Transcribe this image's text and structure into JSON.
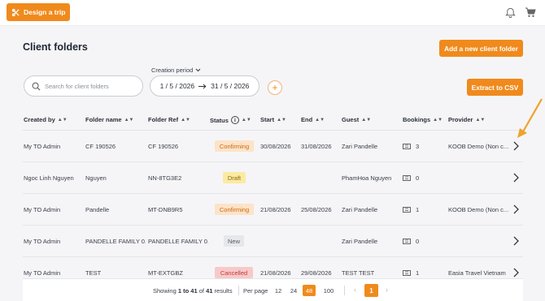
{
  "topbar": {
    "design_label": "Design a trip"
  },
  "page": {
    "title": "Client folders",
    "add_label": "Add a new client folder",
    "extract_label": "Extract to CSV"
  },
  "search": {
    "placeholder": "Search for client folders"
  },
  "period": {
    "label": "Creation period",
    "from": "1 / 5 / 2026",
    "to": "31 / 5 / 2026",
    "add": "+"
  },
  "table": {
    "headers": {
      "created_by": "Created by",
      "folder_name": "Folder name",
      "folder_ref": "Folder Ref",
      "status": "Status",
      "start": "Start",
      "end": "End",
      "guest": "Guest",
      "bookings": "Bookings",
      "provider": "Provider"
    },
    "rows": [
      {
        "created_by": "My TO Admin",
        "folder_name": "CF 190526",
        "folder_ref": "CF 190526",
        "status": "Confirming",
        "start": "30/08/2026",
        "end": "31/08/2026",
        "guest": "Zari Pandelle",
        "bookings": "3",
        "provider": "KOOB Demo (Non c..."
      },
      {
        "created_by": "Ngoc Linh Nguyen",
        "folder_name": "Nguyen",
        "folder_ref": "NN-8TG3E2",
        "status": "Draft",
        "start": "",
        "end": "",
        "guest": "PhamHoa Nguyen",
        "bookings": "0",
        "provider": ""
      },
      {
        "created_by": "My TO Admin",
        "folder_name": "Pandelle",
        "folder_ref": "MT-DNB9R5",
        "status": "Confirming",
        "start": "21/08/2026",
        "end": "25/08/2026",
        "guest": "Zari Pandelle",
        "bookings": "1",
        "provider": "KOOB Demo (Non c..."
      },
      {
        "created_by": "My TO Admin",
        "folder_name": "PANDELLE FAMILY 0...",
        "folder_ref": "PANDELLE FAMILY 0...",
        "status": "New",
        "start": "",
        "end": "",
        "guest": "Zari Pandelle",
        "bookings": "0",
        "provider": ""
      },
      {
        "created_by": "My TO Admin",
        "folder_name": "TEST",
        "folder_ref": "MT-EXTGBZ",
        "status": "Cancelled",
        "start": "21/08/2026",
        "end": "29/08/2026",
        "guest": "TEST TEST",
        "bookings": "1",
        "provider": "Easia Travel Vietnam"
      }
    ]
  },
  "pagination": {
    "showing_prefix": "Showing",
    "range": "1 to 41",
    "of_label": "of",
    "total": "41",
    "results_label": "results",
    "per_page_label": "Per page",
    "options": [
      "12",
      "24",
      "48",
      "100"
    ],
    "selected": "48",
    "current_page": "1"
  },
  "colors": {
    "accent": "#f08a1c"
  }
}
